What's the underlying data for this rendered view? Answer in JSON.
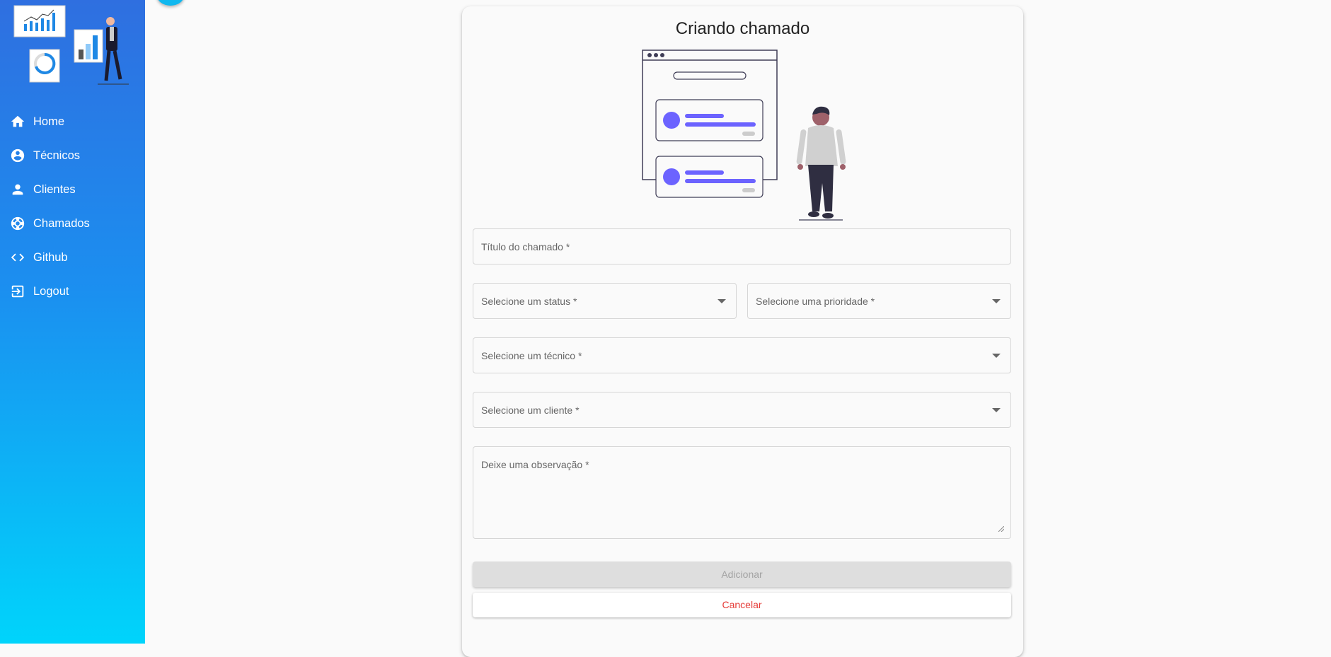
{
  "sidebar": {
    "items": [
      {
        "label": "Home",
        "icon": "home-icon"
      },
      {
        "label": "Técnicos",
        "icon": "account-circle-icon"
      },
      {
        "label": "Clientes",
        "icon": "person-icon"
      },
      {
        "label": "Chamados",
        "icon": "support-icon"
      },
      {
        "label": "Github",
        "icon": "code-icon"
      },
      {
        "label": "Logout",
        "icon": "logout-icon"
      }
    ]
  },
  "form": {
    "title": "Criando chamado",
    "titulo_label": "Título do chamado *",
    "status_label": "Selecione um status *",
    "prioridade_label": "Selecione uma prioridade *",
    "tecnico_label": "Selecione um técnico *",
    "cliente_label": "Selecione um cliente *",
    "observacao_label": "Deixe uma observação *",
    "add_label": "Adicionar",
    "cancel_label": "Cancelar"
  },
  "colors": {
    "sidebar_gradient_top": "#2f6fe0",
    "sidebar_gradient_bottom": "#00d4fb",
    "accent_purple": "#6c63ff",
    "cancel_red": "#e53935"
  }
}
